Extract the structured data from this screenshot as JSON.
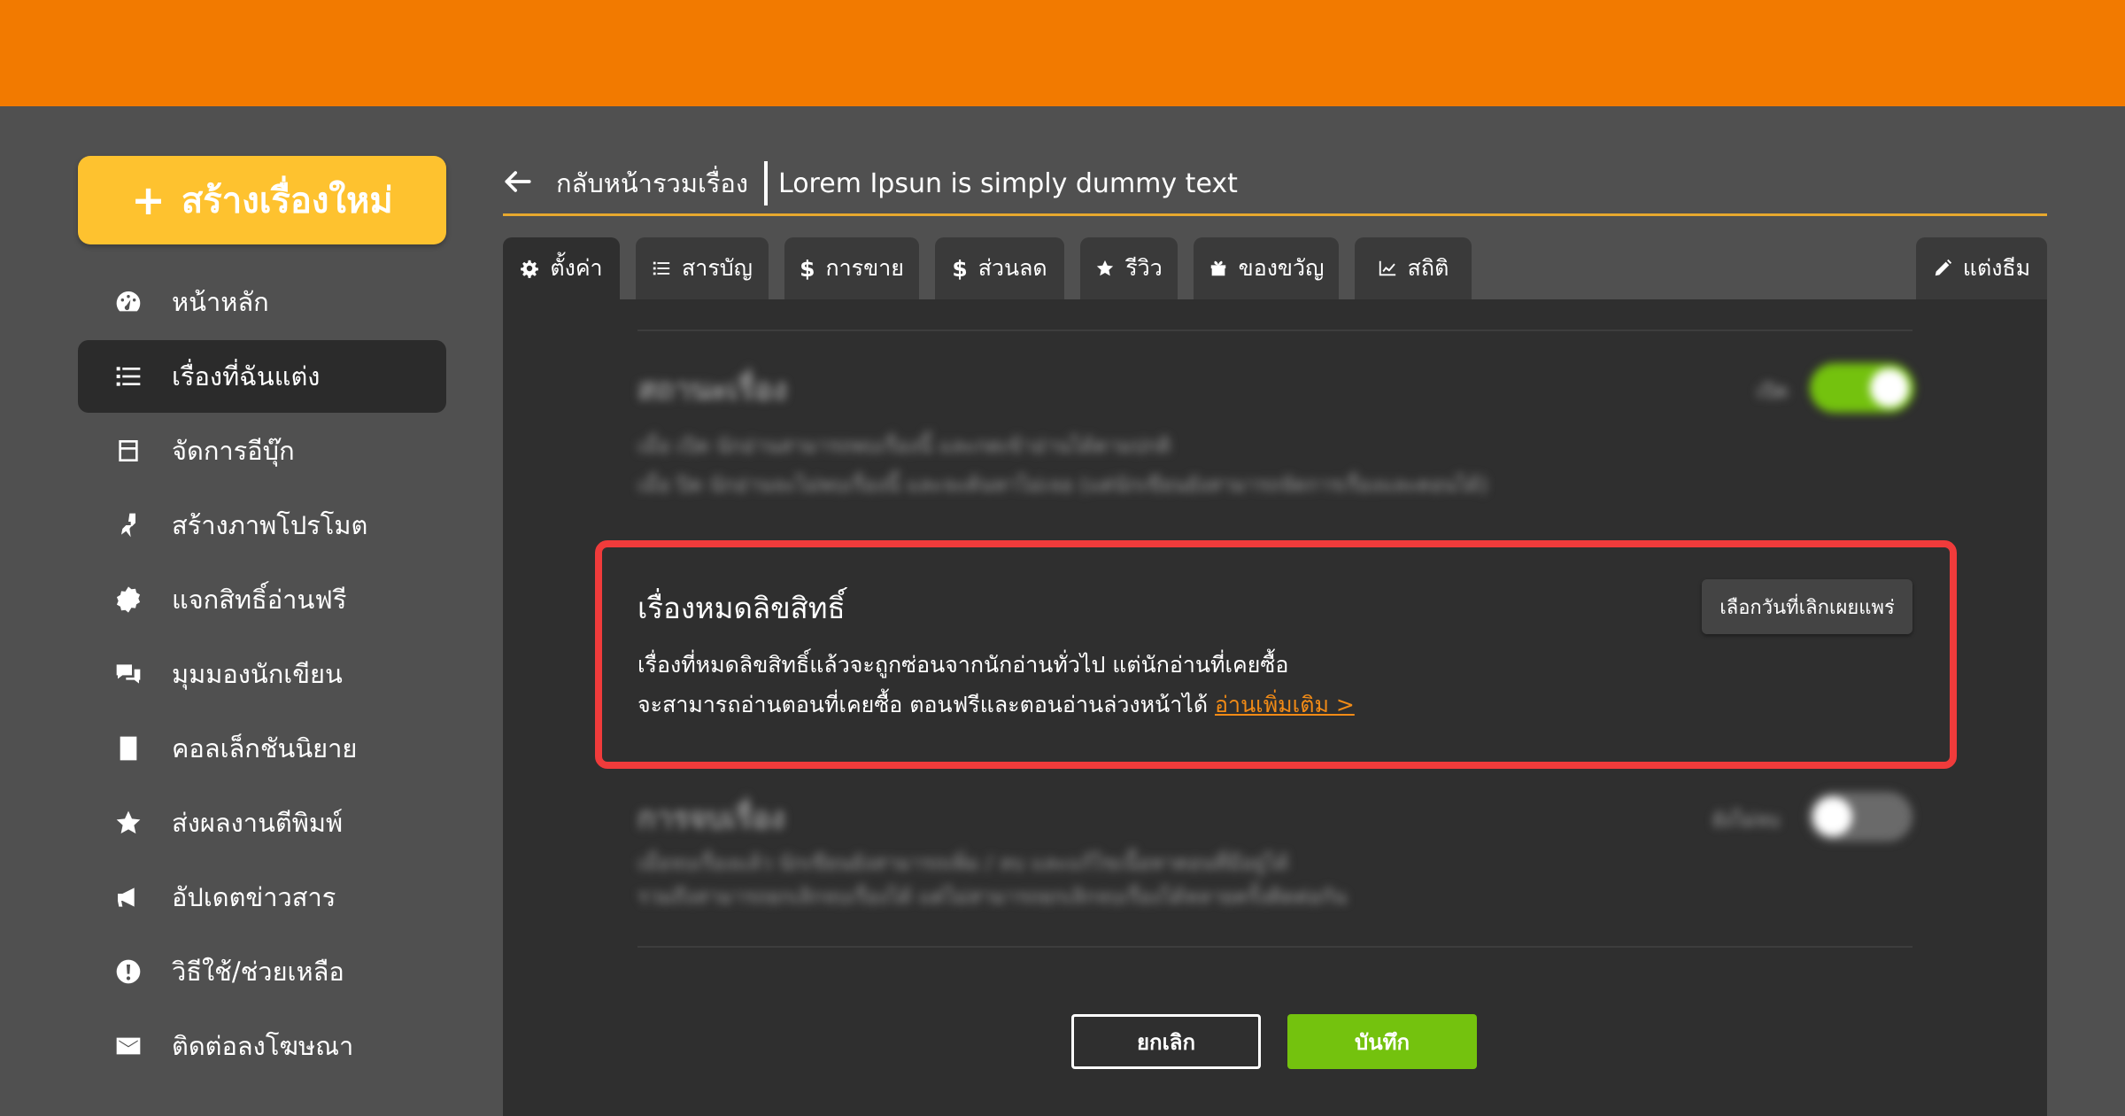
{
  "sidebar": {
    "create_button": "สร้างเรื่องใหม่",
    "items": [
      {
        "label": "หน้าหลัก",
        "icon": "dashboard-icon"
      },
      {
        "label": "เรื่องที่ฉันแต่ง",
        "icon": "list-icon",
        "active": true
      },
      {
        "label": "จัดการอีบุ๊ก",
        "icon": "ebook-icon"
      },
      {
        "label": "สร้างภาพโปรโมต",
        "icon": "paint-brush-icon"
      },
      {
        "label": "แจกสิทธิ์อ่านฟรี",
        "icon": "free-badge-icon"
      },
      {
        "label": "มุมมองนักเขียน",
        "icon": "chat-bubbles-icon"
      },
      {
        "label": "คอลเล็กชันนิยาย",
        "icon": "book-icon"
      },
      {
        "label": "ส่งผลงานตีพิมพ์",
        "icon": "star-icon"
      },
      {
        "label": "อัปเดตข่าวสาร",
        "icon": "megaphone-icon"
      },
      {
        "label": "วิธีใช้/ช่วยเหลือ",
        "icon": "info-icon"
      },
      {
        "label": "ติดต่อลงโฆษณา",
        "icon": "envelope-icon"
      }
    ]
  },
  "header": {
    "back_label": "กลับหน้ารวมเรื่อง",
    "story_title": "Lorem Ipsun is simply dummy text"
  },
  "tabs": [
    {
      "label": "ตั้งค่า",
      "icon": "gear-icon",
      "active": true
    },
    {
      "label": "สารบัญ",
      "icon": "list-icon"
    },
    {
      "label": "การขาย",
      "icon": "dollar-icon"
    },
    {
      "label": "ส่วนลด",
      "icon": "dollar-icon"
    },
    {
      "label": "รีวิว",
      "icon": "star-icon"
    },
    {
      "label": "ของขวัญ",
      "icon": "gift-icon"
    },
    {
      "label": "สถิติ",
      "icon": "chart-icon"
    },
    {
      "label": "แต่งธีม",
      "icon": "pencil-icon"
    }
  ],
  "status_section": {
    "title": "สถานะเรื่อง",
    "toggle_label": "เปิด",
    "toggle_on": true,
    "line1": "เมื่อ เปิด นักอ่านสามารถพบเรื่องนี้ และกดเข้าอ่านได้ตามปกติ",
    "line2": "เมื่อ ปิด นักอ่านจะไม่พบเรื่องนี้ และจะค้นหาไม่เจอ (แต่นักเขียนยังสามารถจัดการเรื่องและตอนได้)"
  },
  "expired_section": {
    "title": "เรื่องหมดลิขสิทธิ์",
    "line1": "เรื่องที่หมดลิขสิทธิ์แล้วจะถูกซ่อนจากนักอ่านทั่วไป แต่นักอ่านที่เคยซื้อ",
    "line2": "จะสามารถอ่านตอนที่เคยซื้อ ตอนฟรีและตอนอ่านล่วงหน้าได้",
    "link": "อ่านเพิ่มเติม >",
    "button": "เลือกวันที่เลิกเผยแพร่"
  },
  "ending_section": {
    "title": "การจบเรื่อง",
    "toggle_label": "ยังไม่จบ",
    "toggle_on": false,
    "line1": "เมื่อจบเรื่องแล้ว นักเขียนยังสามารถเพิ่ม / ลบ และแก้ไขเนื้อหาตอนที่มีอยู่ได้",
    "line2": "รวมถึงสามารถยกเลิกจบเรื่องได้ แต่ไม่สามารถยกเลิกจบเรื่องได้หลายครั้งติดต่อกัน"
  },
  "actions": {
    "cancel": "ยกเลิก",
    "save": "บันทึก"
  },
  "colors": {
    "topbar": "#f27a00",
    "create_button": "#fec22f",
    "accent_green": "#74c20e",
    "highlight_border": "#f03b3b",
    "link": "#f28b16"
  }
}
